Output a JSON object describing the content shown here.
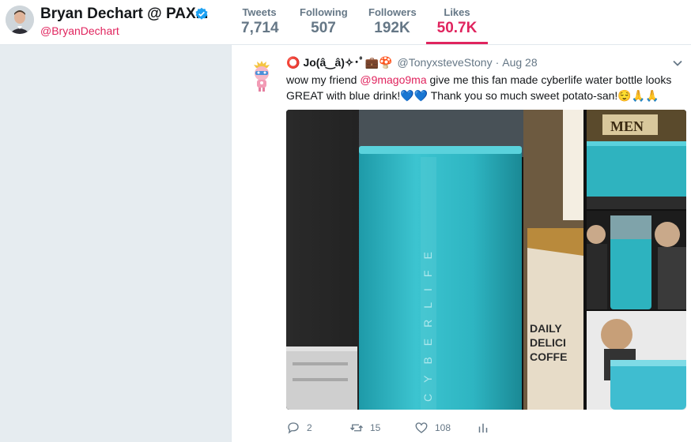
{
  "profile": {
    "name": "Bryan Dechart @ PAX...",
    "handle": "@BryanDechart",
    "verified": true,
    "avatar_icon": "user-avatar-icon"
  },
  "stats": [
    {
      "label": "Tweets",
      "value": "7,714",
      "active": false
    },
    {
      "label": "Following",
      "value": "507",
      "active": false
    },
    {
      "label": "Followers",
      "value": "192K",
      "active": false
    },
    {
      "label": "Likes",
      "value": "50.7K",
      "active": true
    }
  ],
  "tweet": {
    "name_prefix": "⭕",
    "name": "Jo(â‿â)✧･ﾟ💼🍄",
    "handle": "@TonyxsteveStony",
    "separator": "·",
    "date": "Aug 28",
    "text_part1": "wow my friend ",
    "mention": "@9mago9ma",
    "text_part2": " give me this fan made cyberlife water bottle looks GREAT with blue drink!",
    "hearts": "💙💙",
    "text_part3": " Thank you so much sweet potato-san!😌🙏🙏",
    "media": {
      "main_alt": "blue drink bottle",
      "bottle_text": "CYBERLIFE",
      "mug_text_1": "DAILY",
      "mug_text_2": "DELICI",
      "mug_text_3": "COFFE",
      "thumb1_label": "MEN"
    },
    "actions": {
      "reply_count": "2",
      "retweet_count": "15",
      "like_count": "108"
    }
  },
  "colors": {
    "accent": "#e0245e",
    "muted": "#657786",
    "background": "#e6ecf0",
    "drink": "#2bb3c0"
  }
}
